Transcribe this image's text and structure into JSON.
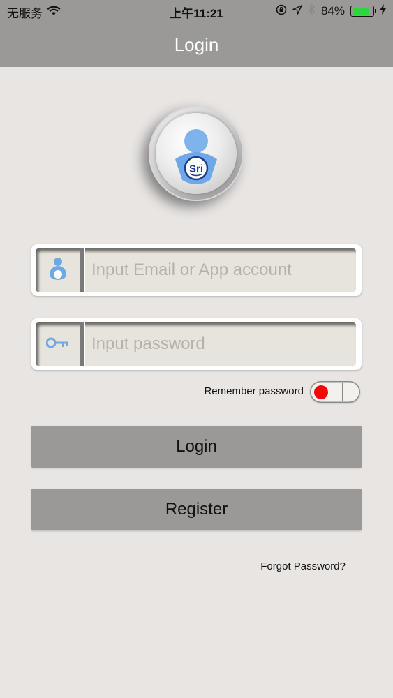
{
  "status_bar": {
    "carrier": "无服务",
    "time": "上午11:21",
    "battery_percent": "84%",
    "battery_level": 0.84,
    "icons": [
      "wifi-icon",
      "orientation-lock-icon",
      "location-arrow-icon",
      "bluetooth-icon",
      "battery-icon",
      "charging-bolt-icon"
    ]
  },
  "nav": {
    "title": "Login"
  },
  "logo": {
    "text": "Sri"
  },
  "form": {
    "account_placeholder": "Input Email or App account",
    "password_placeholder": "Input password",
    "remember_label": "Remember password",
    "remember_on": true
  },
  "buttons": {
    "login": "Login",
    "register": "Register"
  },
  "links": {
    "forgot": "Forgot Password?"
  },
  "colors": {
    "bar": "#9a9998",
    "accent_icon": "#6fa8e8",
    "toggle_knob": "#ff0000",
    "battery": "#2bd83c"
  }
}
